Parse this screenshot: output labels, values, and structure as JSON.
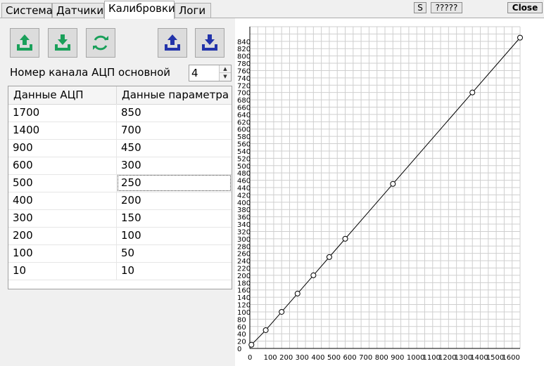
{
  "tabs": [
    {
      "label": "Система"
    },
    {
      "label": "Датчики"
    },
    {
      "label": "Калибровки"
    },
    {
      "label": "Логи"
    }
  ],
  "header_buttons": {
    "s_label": "S",
    "q_label": "?????",
    "close_label": "Close"
  },
  "toolbar": {
    "buttons": [
      {
        "icon": "upload-green-icon"
      },
      {
        "icon": "download-green-icon"
      },
      {
        "icon": "refresh-green-icon"
      },
      {
        "icon": "upload-blue-icon"
      },
      {
        "icon": "download-blue-icon"
      }
    ]
  },
  "channel": {
    "label": "Номер канала АЦП основной",
    "value": "4"
  },
  "table": {
    "headers": [
      "Данные АЦП",
      "Данные параметра"
    ],
    "rows": [
      [
        "1700",
        "850"
      ],
      [
        "1400",
        "700"
      ],
      [
        "900",
        "450"
      ],
      [
        "600",
        "300"
      ],
      [
        "500",
        "250"
      ],
      [
        "400",
        "200"
      ],
      [
        "300",
        "150"
      ],
      [
        "200",
        "100"
      ],
      [
        "100",
        "50"
      ],
      [
        "10",
        "10"
      ]
    ],
    "focused_row": 4
  },
  "colors": {
    "accent_green": "#1aa05a",
    "accent_blue": "#2233aa",
    "grid": "#cfcfcf"
  },
  "chart_data": {
    "type": "line",
    "x": [
      10,
      100,
      200,
      300,
      400,
      500,
      600,
      900,
      1400,
      1700
    ],
    "y": [
      10,
      50,
      100,
      150,
      200,
      250,
      300,
      450,
      700,
      850
    ],
    "xlim": [
      0,
      1700
    ],
    "ylim": [
      0,
      880
    ],
    "x_ticks": [
      "0",
      "100",
      "200",
      "300",
      "400",
      "500",
      "600",
      "700",
      "800",
      "900",
      "1000",
      "1100",
      "1200",
      "1300",
      "1400",
      "1500",
      "1600"
    ],
    "y_ticks": [
      "0",
      "20",
      "40",
      "60",
      "80",
      "100",
      "120",
      "140",
      "160",
      "180",
      "200",
      "220",
      "240",
      "260",
      "280",
      "300",
      "320",
      "340",
      "360",
      "380",
      "400",
      "420",
      "440",
      "460",
      "480",
      "500",
      "520",
      "540",
      "560",
      "580",
      "600",
      "620",
      "640",
      "660",
      "680",
      "700",
      "720",
      "740",
      "760",
      "780",
      "800",
      "820",
      "840"
    ],
    "grid": true,
    "title": "",
    "xlabel": "",
    "ylabel": ""
  }
}
